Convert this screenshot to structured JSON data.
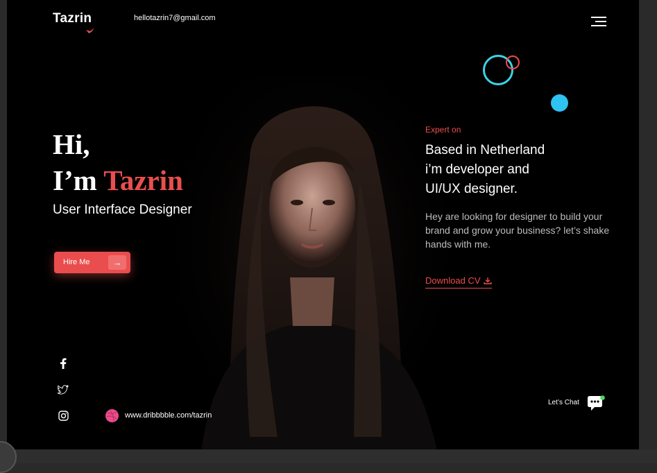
{
  "brand": {
    "logo_text": "Tazrin",
    "email": "hellotazrin7@gmail.com"
  },
  "hero": {
    "greeting_line1": "Hi,",
    "greeting_prefix": "I’m ",
    "name": "Tazrin",
    "role": "User Interface Designer",
    "hire_button_label": "Hire Me",
    "hire_button_arrow": "→"
  },
  "about": {
    "eyebrow": "Expert on",
    "headline_lines": [
      "Based in Netherland",
      "i’m developer and",
      "UI/UX designer."
    ],
    "description": "Hey are looking for designer to build your brand and grow your business? let’s shake hands with me.",
    "download_label": "Download CV"
  },
  "social": {
    "items": [
      "facebook-icon",
      "twitter-icon",
      "instagram-icon"
    ],
    "dribbble_url": "www.dribbbble.com/tazrin"
  },
  "chat": {
    "label": "Let’s Chat"
  },
  "colors": {
    "background": "#000000",
    "accent_red": "#ea4e4e",
    "accent_cyan": "#3cd4e4",
    "online_green": "#4cd964"
  }
}
